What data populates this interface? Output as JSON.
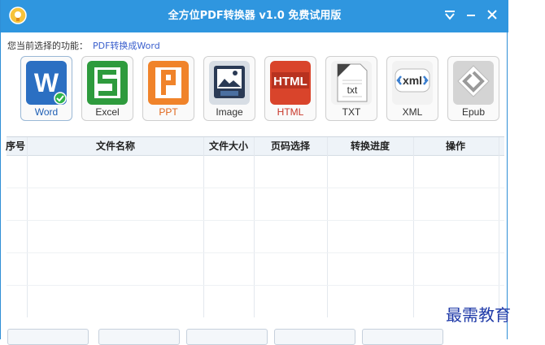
{
  "window": {
    "title": "全方位PDF转换器 v1.0 免费试用版"
  },
  "function_line": {
    "label": "您当前选择的功能：",
    "value": "PDF转换成Word"
  },
  "formats": [
    {
      "label": "Word",
      "tile_color": "#2b6fc2",
      "text_color": "#1f5fb5",
      "glyph": "W",
      "selected": true
    },
    {
      "label": "Excel",
      "tile_color": "#2e9b3d",
      "text_color": "#333333",
      "glyph": "S"
    },
    {
      "label": "PPT",
      "tile_color": "#f0832a",
      "text_color": "#e0661b",
      "glyph": "P"
    },
    {
      "label": "Image",
      "tile_color": "#3c6fa6",
      "text_color": "#333333",
      "glyph": "images"
    },
    {
      "label": "HTML",
      "tile_color": "#d9442b",
      "text_color": "#c8372a",
      "glyph": "HTML"
    },
    {
      "label": "TXT",
      "tile_color": "#e8e8e8",
      "text_color": "#333333",
      "glyph": "txt"
    },
    {
      "label": "XML",
      "tile_color": "#e6e6e6",
      "text_color": "#333333",
      "glyph": "xml"
    },
    {
      "label": "Epub",
      "tile_color": "#dadada",
      "text_color": "#333333",
      "glyph": "epub"
    }
  ],
  "table": {
    "columns": [
      "序号",
      "文件名称",
      "文件大小",
      "页码选择",
      "转换进度",
      "操作"
    ]
  },
  "watermark": "最需教育",
  "colors": {
    "titlebar": "#2f96df",
    "accent_link": "#3a5fcd"
  }
}
